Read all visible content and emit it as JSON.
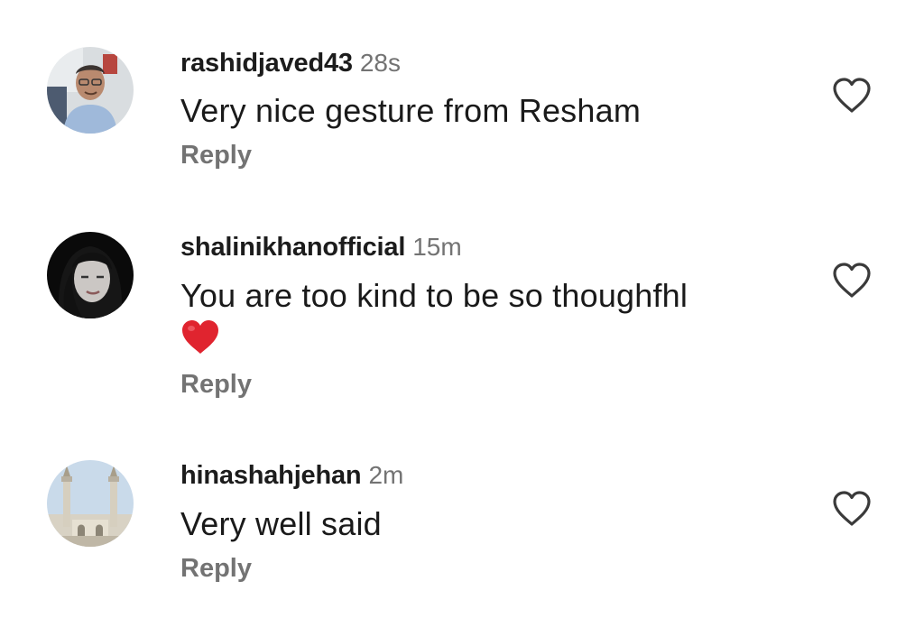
{
  "comments": [
    {
      "username": "rashidjaved43",
      "time": "28s",
      "text": "Very nice gesture from Resham",
      "emoji": "",
      "reply_label": "Reply",
      "avatar_icon": "avatar-man-glasses"
    },
    {
      "username": "shalinikhanofficial",
      "time": "15m",
      "text": "You are too kind to be so thoughfhl",
      "emoji": "red-heart",
      "reply_label": "Reply",
      "avatar_icon": "avatar-woman-dark"
    },
    {
      "username": "hinashahjehan",
      "time": "2m",
      "text": "Very well said",
      "emoji": "",
      "reply_label": "Reply",
      "avatar_icon": "avatar-mosque-minarets"
    }
  ],
  "icons": {
    "like": "heart-outline-icon",
    "emoji": "red-heart-emoji"
  },
  "colors": {
    "secondary_text": "#737373",
    "heart_emoji": "#e0242f"
  }
}
